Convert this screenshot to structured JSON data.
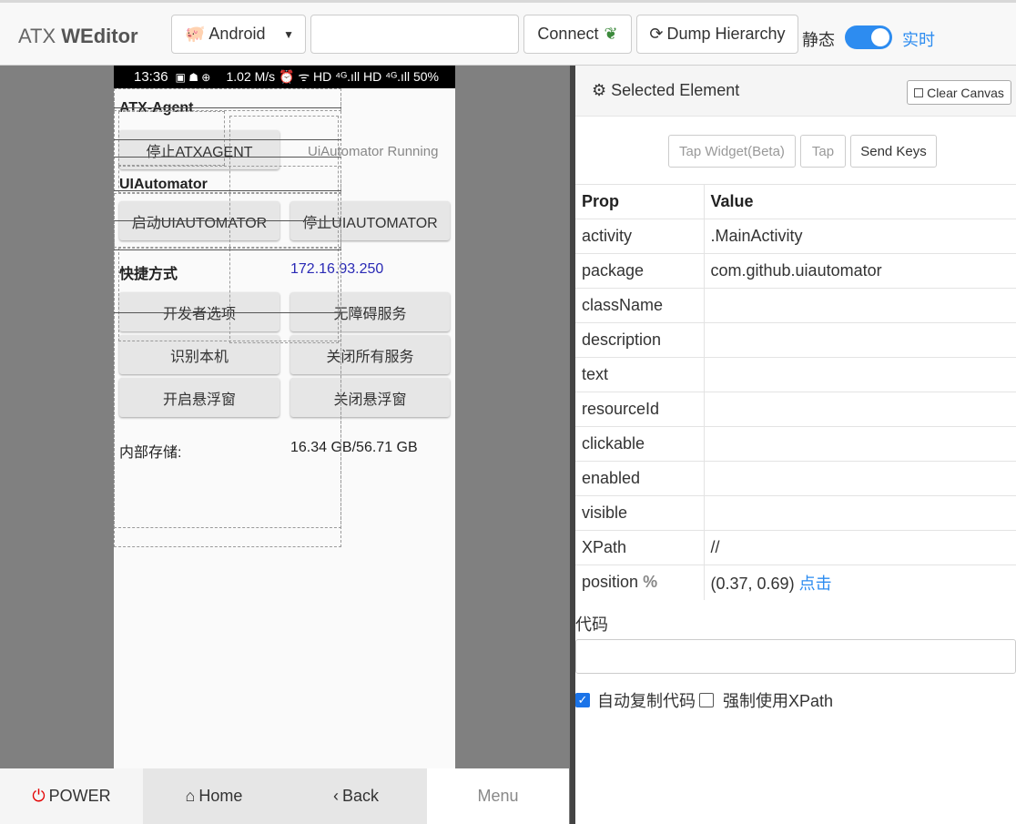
{
  "header": {
    "brand_light": "ATX ",
    "brand_bold": "WEditor",
    "platform_label": "Android",
    "serial_value": "",
    "connect_label": "Connect",
    "dump_label": "Dump Hierarchy",
    "mode_static": "静态",
    "mode_live": "实时",
    "live_mode_on": true,
    "accent_color": "#2d8cf0"
  },
  "phone": {
    "status_time": "13:36",
    "status_right": "1.02 M/s  ⏰ ᯤ HD ⁴ᴳ.ıll HD ⁴ᴳ.ıll 50%",
    "section_agent": "ATX-Agent",
    "stop_agent": "停止ATXAGENT",
    "uia_status": "UiAutomator Running",
    "section_uia": "UIAutomator",
    "start_uia": "启动UIAUTOMATOR",
    "stop_uia": "停止UIAUTOMATOR",
    "shortcuts": "快捷方式",
    "ip": "172.16.93.250",
    "buttons": [
      "开发者选项",
      "无障碍服务",
      "识别本机",
      "关闭所有服务",
      "开启悬浮窗",
      "关闭悬浮窗"
    ],
    "storage_label": "内部存储:",
    "storage_value": "16.34 GB/56.71 GB"
  },
  "nav": {
    "power": "POWER",
    "home": "Home",
    "back": "Back",
    "menu": "Menu"
  },
  "inspector": {
    "title": "Selected Element",
    "clear_canvas": "Clear Canvas",
    "tap_widget": "Tap Widget(Beta)",
    "tap": "Tap",
    "send_keys": "Send Keys",
    "col_prop": "Prop",
    "col_value": "Value",
    "rows": [
      {
        "prop": "activity",
        "value": ".MainActivity"
      },
      {
        "prop": "package",
        "value": "com.github.uiautomator"
      },
      {
        "prop": "className",
        "value": ""
      },
      {
        "prop": "description",
        "value": ""
      },
      {
        "prop": "text",
        "value": ""
      },
      {
        "prop": "resourceId",
        "value": ""
      },
      {
        "prop": "clickable",
        "value": ""
      },
      {
        "prop": "enabled",
        "value": ""
      },
      {
        "prop": "visible",
        "value": ""
      },
      {
        "prop": "XPath",
        "value": "//"
      }
    ],
    "position_label": "position",
    "position_pct": "%",
    "position_value": "(0.37, 0.69)",
    "position_click": "点击",
    "code_label": "代码",
    "code_value": "",
    "auto_copy": "自动复制代码",
    "auto_copy_checked": true,
    "force_xpath": "强制使用XPath",
    "force_xpath_checked": false
  }
}
